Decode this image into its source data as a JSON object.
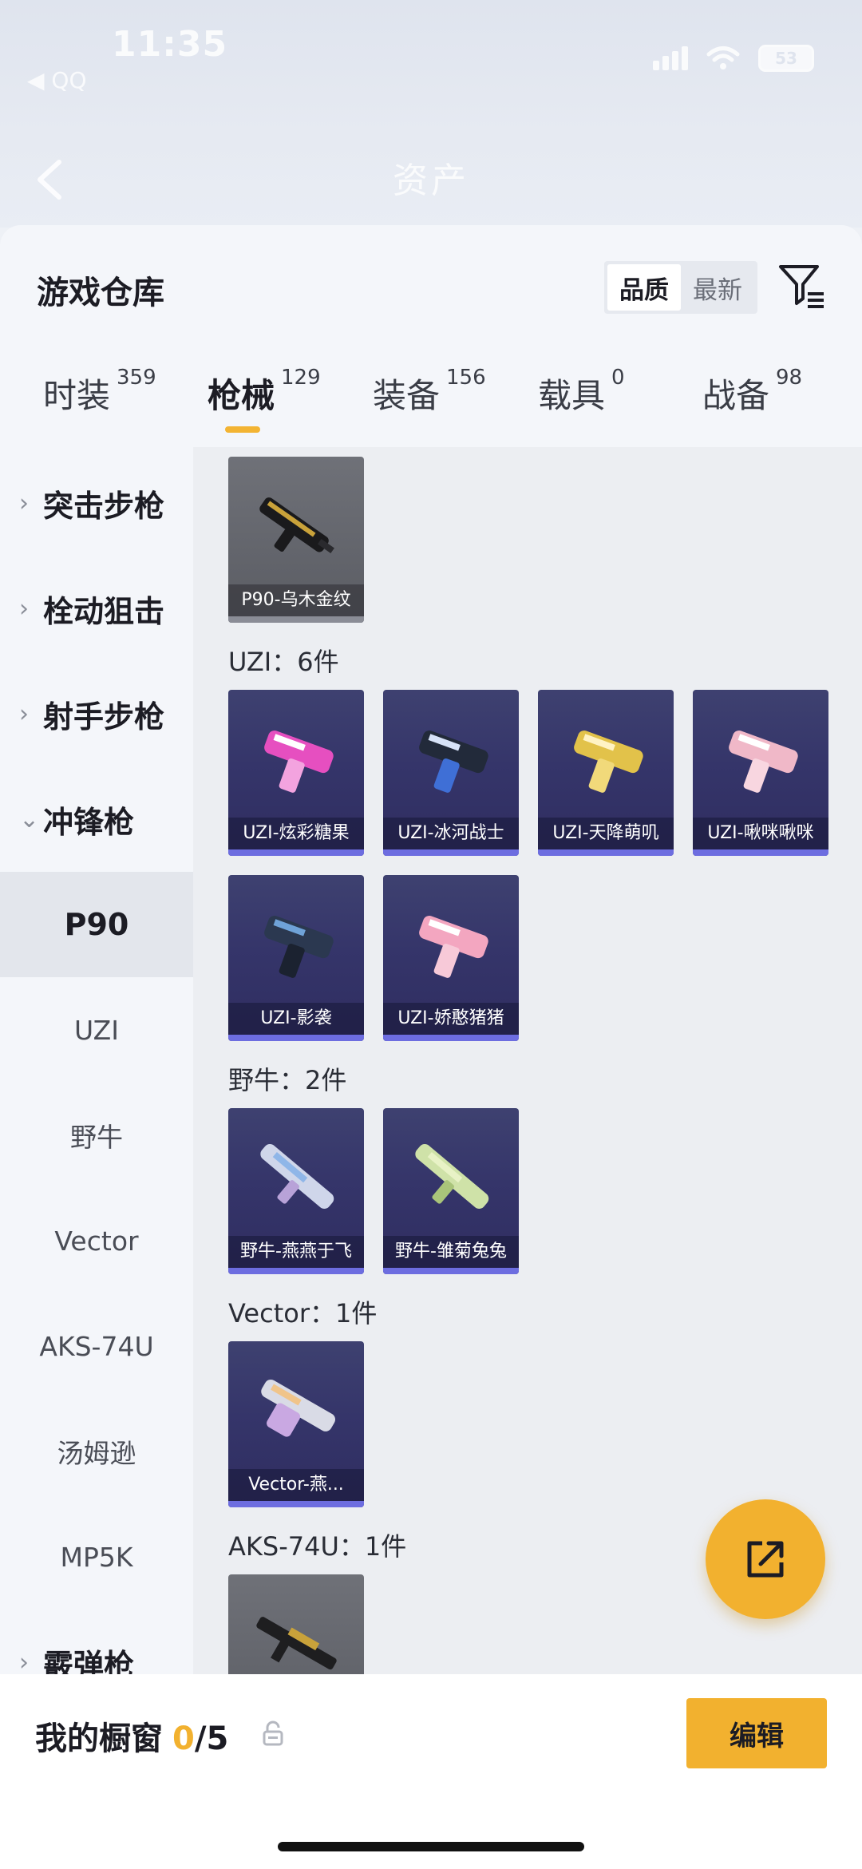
{
  "status_bar": {
    "time": "11:35",
    "sub": "◀ QQ",
    "battery": "53"
  },
  "header": {
    "title": "资产"
  },
  "panel": {
    "title": "游戏仓库",
    "sort_options": [
      "品质",
      "最新"
    ]
  },
  "tabs": [
    {
      "label": "时装",
      "count": "359"
    },
    {
      "label": "枪械",
      "count": "129"
    },
    {
      "label": "装备",
      "count": "156"
    },
    {
      "label": "载具",
      "count": "0"
    },
    {
      "label": "战备",
      "count": "98"
    }
  ],
  "sidebar": {
    "categories": [
      "突击步枪",
      "栓动狙击",
      "射手步枪",
      "冲锋枪",
      "霰弹枪"
    ],
    "subs": [
      "P90",
      "UZI",
      "野牛",
      "Vector",
      "AKS-74U",
      "汤姆逊",
      "MP5K"
    ]
  },
  "groups": [
    {
      "label": "UZI：6件"
    },
    {
      "label": "野牛：2件"
    },
    {
      "label": "Vector：1件"
    },
    {
      "label": "AKS-74U：1件"
    }
  ],
  "items": [
    {
      "name": "P90-乌木金纹"
    },
    {
      "name": "UZI-炫彩糖果"
    },
    {
      "name": "UZI-冰河战士"
    },
    {
      "name": "UZI-天降萌叽"
    },
    {
      "name": "UZI-啾咪啾咪"
    },
    {
      "name": "UZI-影袭"
    },
    {
      "name": "UZI-娇憨猪猪"
    },
    {
      "name": "野牛-燕燕于飞"
    },
    {
      "name": "野牛-雏菊兔兔"
    },
    {
      "name": "Vector-燕..."
    },
    {
      "name": ""
    }
  ],
  "bottom": {
    "showcase_label": "我的橱窗",
    "showcase_count": "0",
    "showcase_total": "/5",
    "edit_label": "编辑"
  },
  "colors": {
    "accent": "#f2b12f",
    "card_purple": "#35356a",
    "card_bar": "#6d6de0"
  }
}
